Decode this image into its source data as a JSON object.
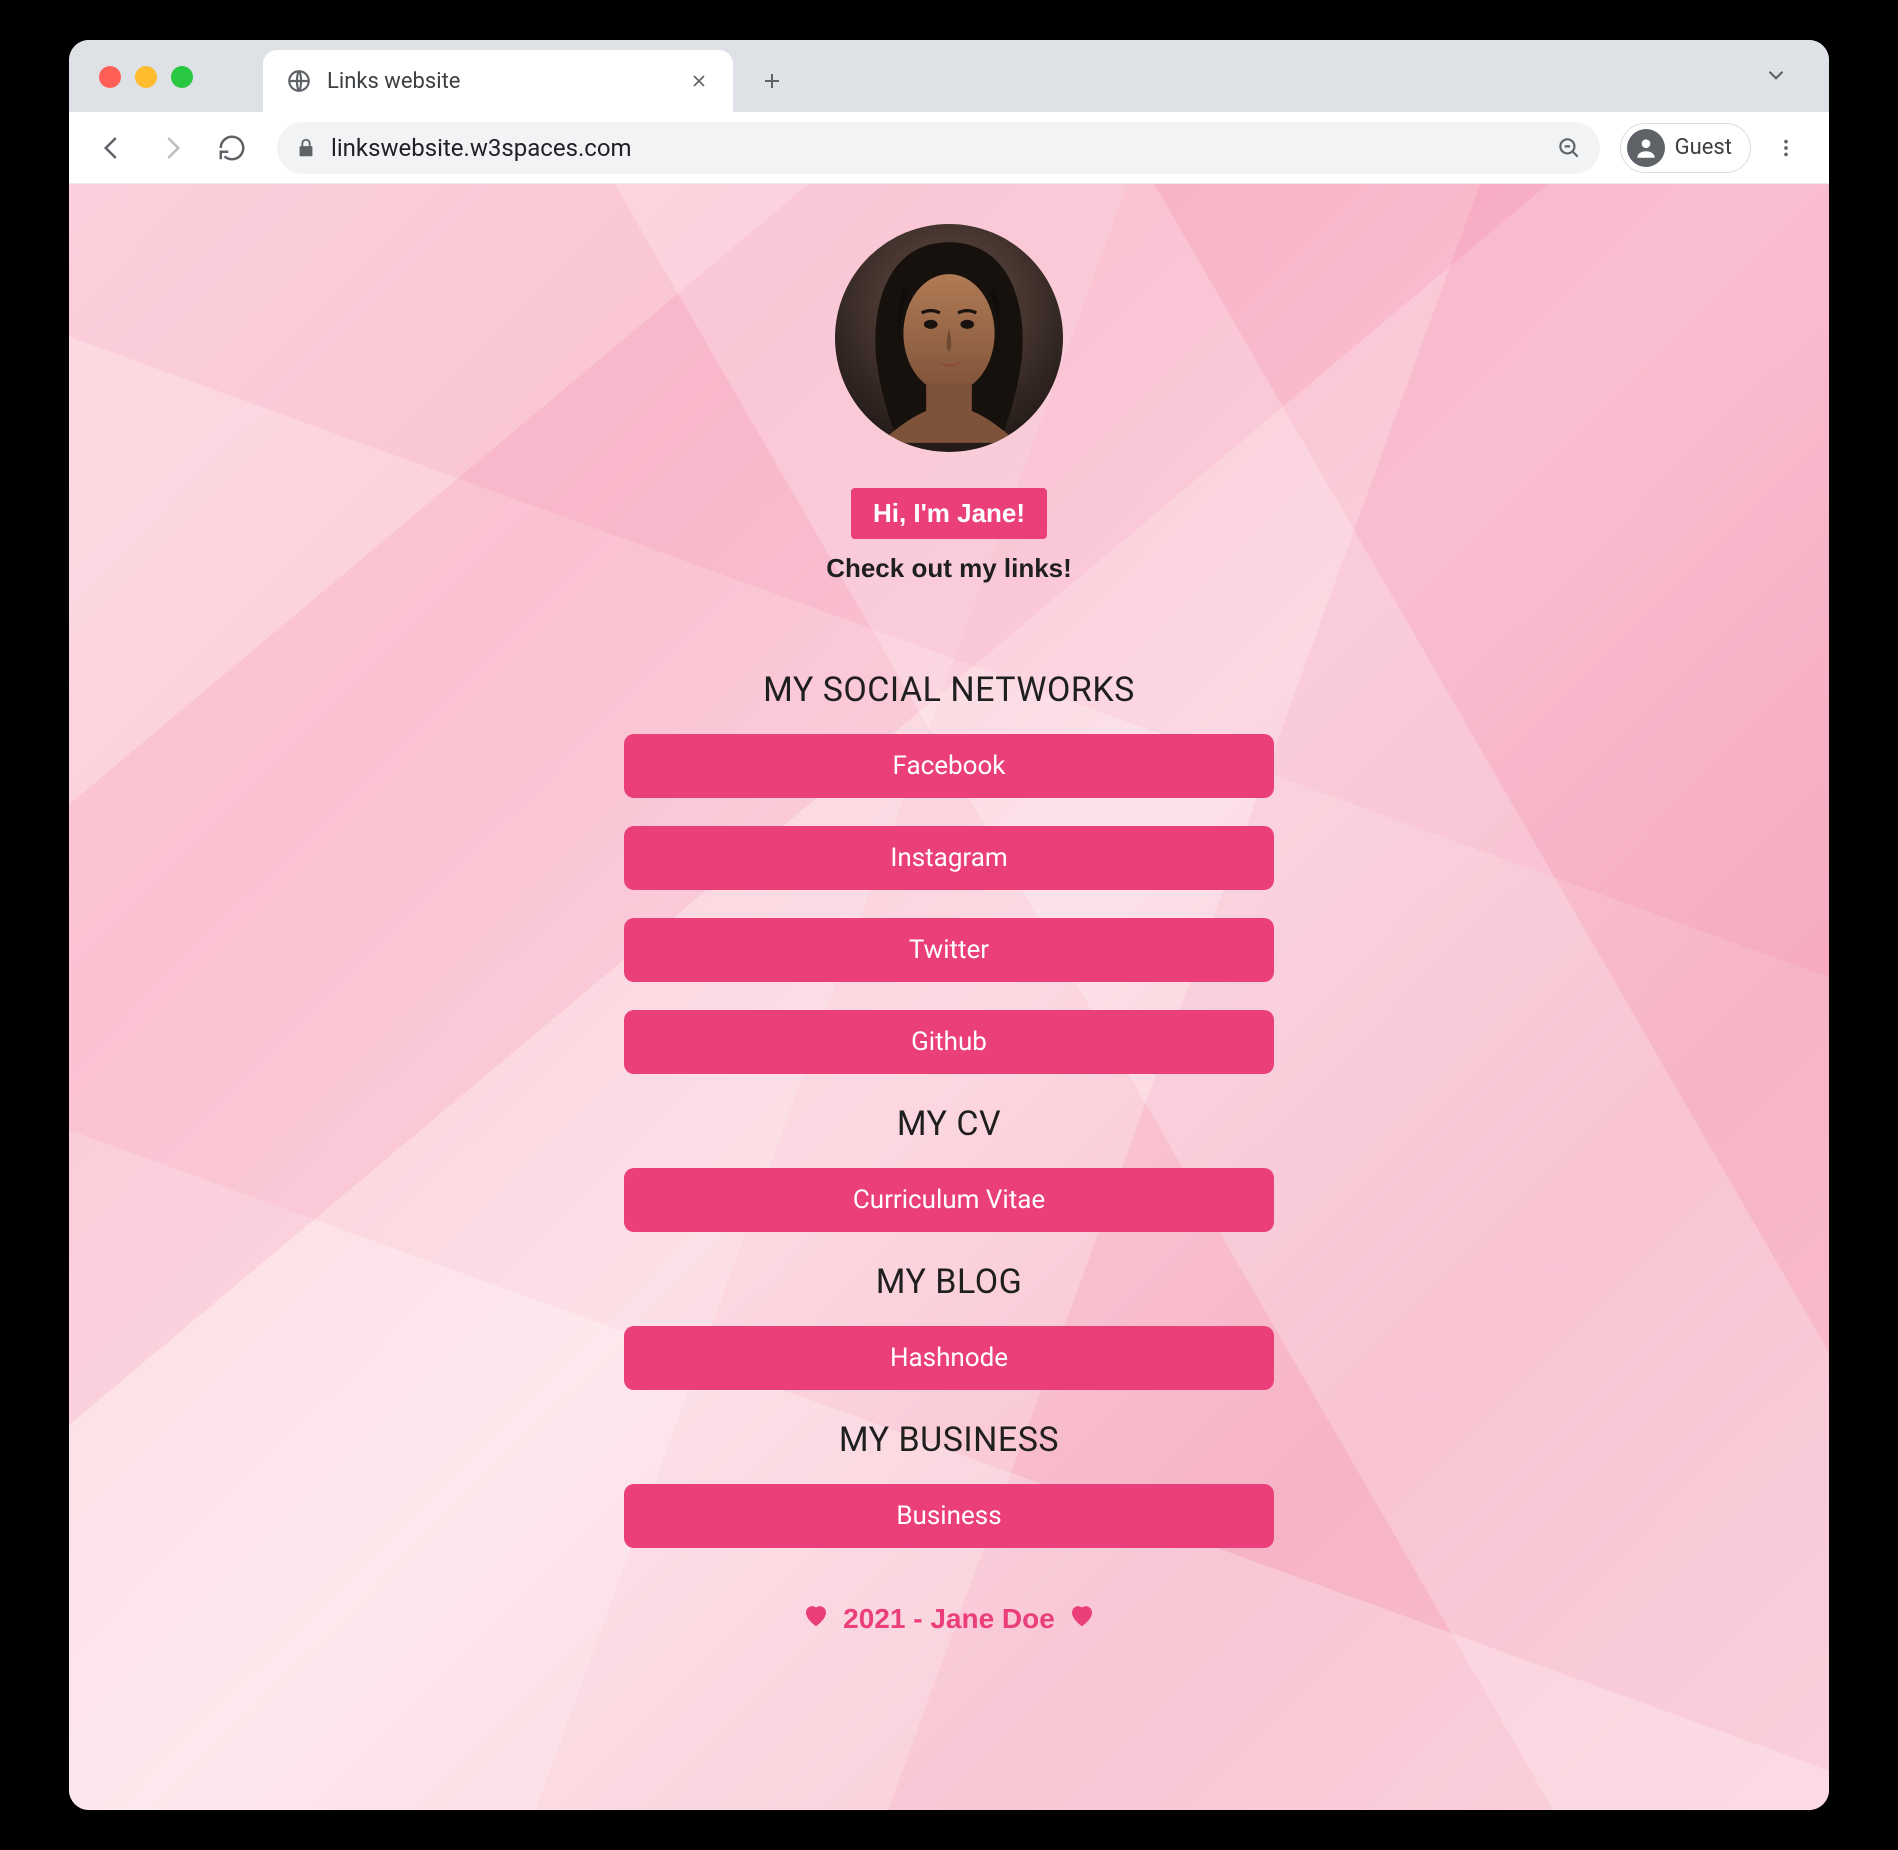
{
  "browser": {
    "tab_title": "Links website",
    "url": "linkswebsite.w3spaces.com",
    "guest_label": "Guest"
  },
  "profile": {
    "greeting": "Hi, I'm Jane!",
    "subtitle": "Check out my links!"
  },
  "sections": {
    "social": {
      "title": "MY SOCIAL NETWORKS",
      "links": [
        "Facebook",
        "Instagram",
        "Twitter",
        "Github"
      ]
    },
    "cv": {
      "title": "MY CV",
      "links": [
        "Curriculum Vitae"
      ]
    },
    "blog": {
      "title": "MY BLOG",
      "links": [
        "Hashnode"
      ]
    },
    "business": {
      "title": "MY BUSINESS",
      "links": [
        "Business"
      ]
    }
  },
  "footer": {
    "text": "2021 - Jane Doe"
  },
  "colors": {
    "accent": "#ea3f7a"
  }
}
